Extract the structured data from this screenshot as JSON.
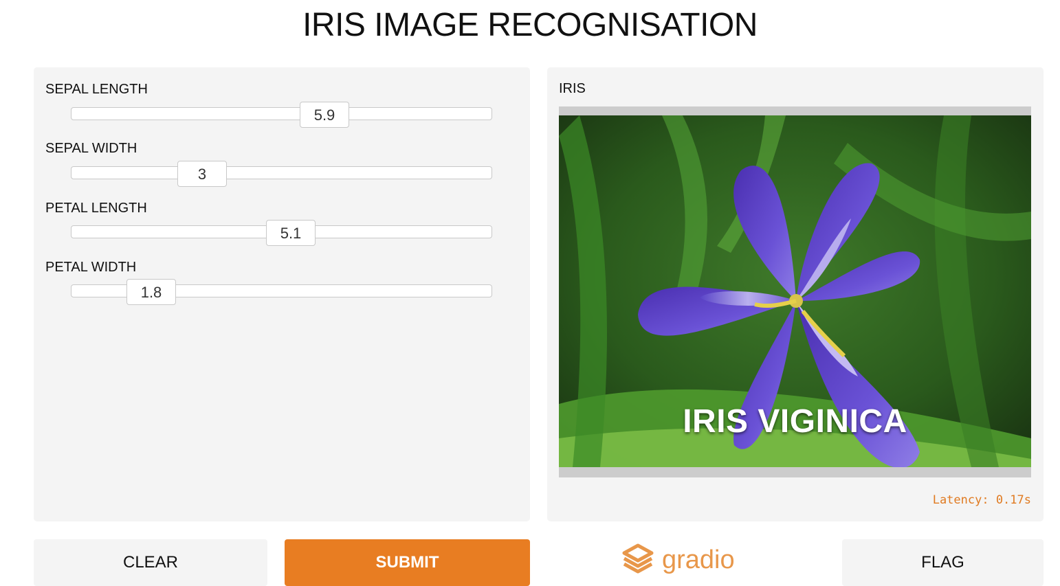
{
  "page": {
    "title": "IRIS IMAGE RECOGNISATION"
  },
  "inputs": {
    "sliders": [
      {
        "label": "SEPAL LENGTH",
        "value": "5.9",
        "fraction": 0.6
      },
      {
        "label": "SEPAL WIDTH",
        "value": "3",
        "fraction": 0.31
      },
      {
        "label": "PETAL LENGTH",
        "value": "5.1",
        "fraction": 0.52
      },
      {
        "label": "PETAL WIDTH",
        "value": "1.8",
        "fraction": 0.19
      }
    ]
  },
  "output": {
    "label": "IRIS",
    "image_caption": "IRIS VIGINICA",
    "latency": "Latency: 0.17s"
  },
  "actions": {
    "clear_label": "CLEAR",
    "submit_label": "SUBMIT",
    "flag_label": "FLAG"
  },
  "brand": {
    "name": "gradio",
    "icon": "gradio-logo-icon"
  },
  "colors": {
    "accent": "#e87d22",
    "panel": "#f4f4f4",
    "latency": "#e07a20",
    "petal": "#5b3fc4",
    "foliage": "#2f6a22"
  }
}
